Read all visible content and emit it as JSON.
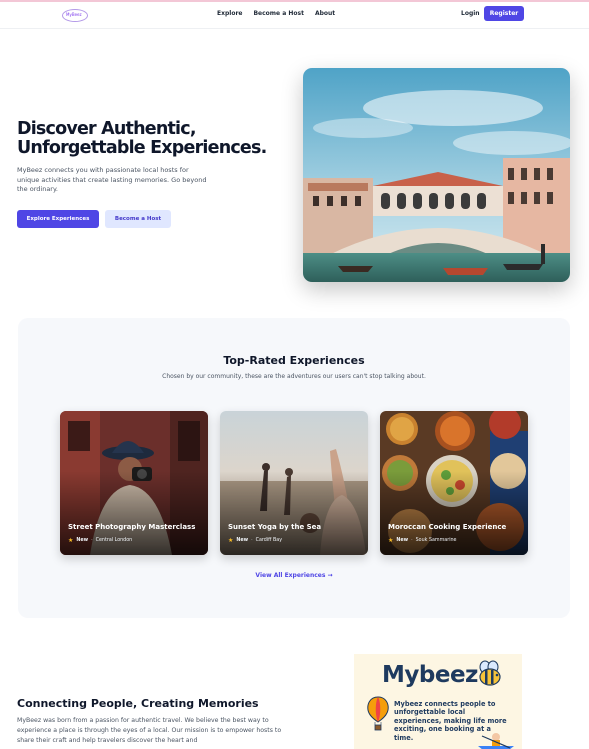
{
  "nav": {
    "logo_text": "MyBeez",
    "links": [
      "Explore",
      "Become a Host",
      "About"
    ],
    "login_label": "Login",
    "register_label": "Register"
  },
  "hero": {
    "title_line1": "Discover Authentic,",
    "title_line2": "Unforgettable Experiences.",
    "description": "MyBeez connects you with passionate local hosts for unique activities that create lasting memories. Go beyond the ordinary.",
    "primary_cta": "Explore Experiences",
    "secondary_cta": "Become a Host"
  },
  "experiences": {
    "title": "Top-Rated Experiences",
    "subtitle": "Chosen by our community, these are the adventures our users can't stop talking about.",
    "cards": [
      {
        "title": "Street Photography Masterclass",
        "badge": "New",
        "location": "Central London"
      },
      {
        "title": "Sunset Yoga by the Sea",
        "badge": "New",
        "location": "Cardiff Bay"
      },
      {
        "title": "Moroccan Cooking Experience",
        "badge": "New",
        "location": "Souk Sammarine"
      }
    ],
    "view_all": "View All Experiences →"
  },
  "about": {
    "title": "Connecting People, Creating Memories",
    "text": "MyBeez was born from a passion for authentic travel. We believe the best way to experience a place is through the eyes of a local. Our mission is to empower hosts to share their craft and help travelers discover the heart and",
    "card_logo": "Mybeez",
    "card_text": "Mybeez connects people to unforgettable local experiences, making life more exciting, one booking at a time."
  },
  "colors": {
    "accent": "#4f46e5",
    "accent_light": "#e0e7ff",
    "star": "#fbbf24"
  }
}
